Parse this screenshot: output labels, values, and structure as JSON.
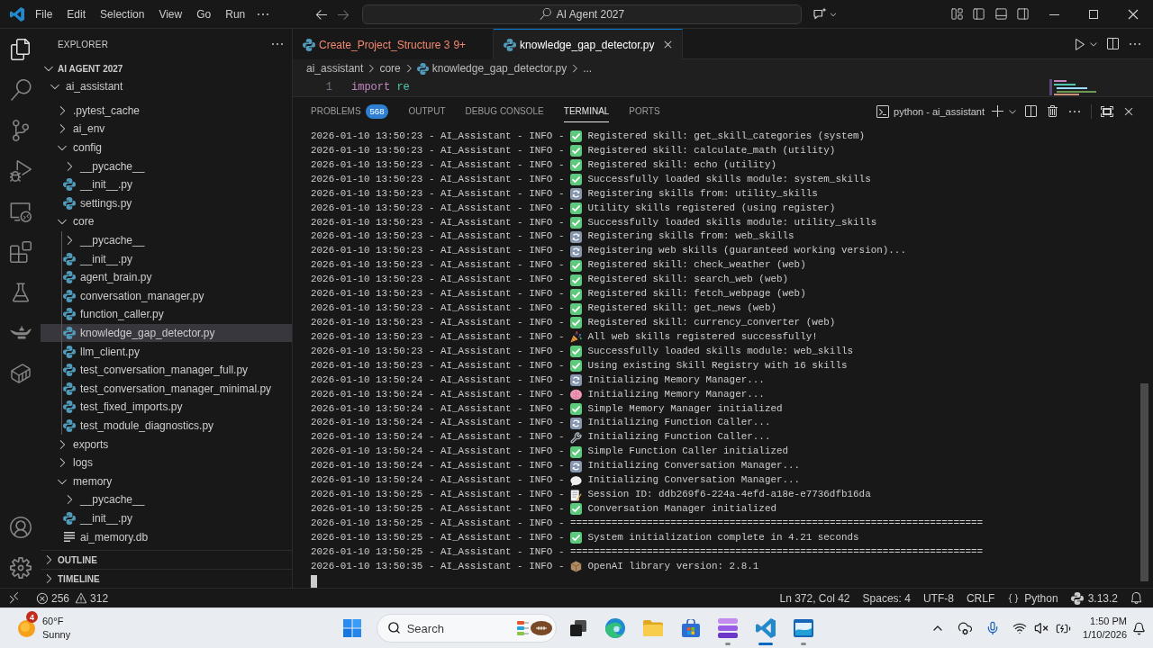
{
  "title_bar": {
    "menus": [
      "File",
      "Edit",
      "Selection",
      "View",
      "Go",
      "Run"
    ],
    "command_center": "AI Agent 2027"
  },
  "activity_bar": {
    "items": [
      {
        "kind": "explorer",
        "selected": true
      },
      {
        "kind": "search",
        "selected": false
      },
      {
        "kind": "source_control",
        "selected": false
      },
      {
        "kind": "run_debug",
        "selected": false
      },
      {
        "kind": "remote",
        "selected": false
      },
      {
        "kind": "extensions",
        "selected": false
      },
      {
        "kind": "testing",
        "selected": false
      },
      {
        "kind": "lamp",
        "selected": false
      },
      {
        "kind": "container",
        "selected": false
      }
    ],
    "bottom_items": [
      {
        "kind": "account"
      },
      {
        "kind": "settings"
      }
    ]
  },
  "sidebar": {
    "title": "EXPLORER",
    "workspace": {
      "label": "AI AGENT 2027",
      "expanded": true
    },
    "tree": [
      {
        "label": "ai_assistant",
        "kind": "folder",
        "expanded": true,
        "selected": false,
        "children": [
          {
            "label": ".pytest_cache",
            "kind": "folder",
            "expanded": false,
            "selected": false
          },
          {
            "label": "ai_env",
            "kind": "folder",
            "expanded": false,
            "selected": false
          },
          {
            "label": "config",
            "kind": "folder",
            "expanded": true,
            "selected": false,
            "children": [
              {
                "label": "__pycache__",
                "kind": "folder",
                "expanded": false,
                "selected": false
              },
              {
                "label": "__init__.py",
                "kind": "python",
                "selected": false
              },
              {
                "label": "settings.py",
                "kind": "python",
                "selected": false
              }
            ]
          },
          {
            "label": "core",
            "kind": "folder",
            "expanded": true,
            "selected": false,
            "children": [
              {
                "label": "__pycache__",
                "kind": "folder",
                "expanded": false,
                "selected": false
              },
              {
                "label": "__init__.py",
                "kind": "python",
                "selected": false
              },
              {
                "label": "agent_brain.py",
                "kind": "python",
                "selected": false
              },
              {
                "label": "conversation_manager.py",
                "kind": "python",
                "selected": false
              },
              {
                "label": "function_caller.py",
                "kind": "python",
                "selected": false
              },
              {
                "label": "knowledge_gap_detector.py",
                "kind": "python",
                "selected": true
              },
              {
                "label": "llm_client.py",
                "kind": "python",
                "selected": false
              },
              {
                "label": "test_conversation_manager_full.py",
                "kind": "python",
                "selected": false
              },
              {
                "label": "test_conversation_manager_minimal.py",
                "kind": "python",
                "selected": false
              },
              {
                "label": "test_fixed_imports.py",
                "kind": "python",
                "selected": false
              },
              {
                "label": "test_module_diagnostics.py",
                "kind": "python",
                "selected": false
              }
            ]
          },
          {
            "label": "exports",
            "kind": "folder",
            "expanded": false,
            "selected": false
          },
          {
            "label": "logs",
            "kind": "folder",
            "expanded": false,
            "selected": false
          },
          {
            "label": "memory",
            "kind": "folder",
            "expanded": true,
            "selected": false,
            "children": [
              {
                "label": "__pycache__",
                "kind": "folder",
                "expanded": false,
                "selected": false
              },
              {
                "label": "__init__.py",
                "kind": "python",
                "selected": false
              },
              {
                "label": "ai_memory.db",
                "kind": "text",
                "selected": false
              }
            ]
          }
        ]
      }
    ],
    "sections": [
      {
        "label": "OUTLINE",
        "expanded": false
      },
      {
        "label": "TIMELINE",
        "expanded": false
      }
    ]
  },
  "editor": {
    "tabs": [
      {
        "label": "Create_Project_Structure 3",
        "problems": "9+",
        "has_errors": true,
        "selected": false
      },
      {
        "label": "knowledge_gap_detector.py",
        "has_errors": false,
        "selected": true
      }
    ],
    "breadcrumbs": [
      {
        "label": "ai_assistant",
        "kind": "folder"
      },
      {
        "label": "core",
        "kind": "folder"
      },
      {
        "label": "knowledge_gap_detector.py",
        "kind": "python"
      },
      {
        "label": "...",
        "kind": "symbol"
      }
    ],
    "lines": [
      {
        "number": "1",
        "tokens": [
          {
            "text": "import",
            "kind": "keyword"
          },
          {
            "text": "re",
            "kind": "plain"
          }
        ]
      }
    ]
  },
  "panel": {
    "tabs": [
      {
        "label": "PROBLEMS",
        "badge": "568",
        "selected": false
      },
      {
        "label": "OUTPUT",
        "selected": false
      },
      {
        "label": "DEBUG CONSOLE",
        "selected": false
      },
      {
        "label": "TERMINAL",
        "selected": true
      },
      {
        "label": "PORTS",
        "selected": false
      }
    ],
    "terminal": {
      "name": "python - ai_assistant",
      "lines": [
        {
          "prefix": "2026-01-10 13:50:23 - AI_Assistant - INFO -",
          "kind": "check",
          "message": "Registered skill: get_skill_categories (system)"
        },
        {
          "prefix": "2026-01-10 13:50:23 - AI_Assistant - INFO -",
          "kind": "check",
          "message": "Registered skill: calculate_math (utility)"
        },
        {
          "prefix": "2026-01-10 13:50:23 - AI_Assistant - INFO -",
          "kind": "check",
          "message": "Registered skill: echo (utility)"
        },
        {
          "prefix": "2026-01-10 13:50:23 - AI_Assistant - INFO -",
          "kind": "check",
          "message": "Successfully loaded skills module: system_skills"
        },
        {
          "prefix": "2026-01-10 13:50:23 - AI_Assistant - INFO -",
          "kind": "sync",
          "message": "Registering skills from: utility_skills"
        },
        {
          "prefix": "2026-01-10 13:50:23 - AI_Assistant - INFO -",
          "kind": "check",
          "message": "Utility skills registered (using register)"
        },
        {
          "prefix": "2026-01-10 13:50:23 - AI_Assistant - INFO -",
          "kind": "check",
          "message": "Successfully loaded skills module: utility_skills"
        },
        {
          "prefix": "2026-01-10 13:50:23 - AI_Assistant - INFO -",
          "kind": "sync",
          "message": "Registering skills from: web_skills"
        },
        {
          "prefix": "2026-01-10 13:50:23 - AI_Assistant - INFO -",
          "kind": "sync",
          "message": "Registering web skills (guaranteed working version)..."
        },
        {
          "prefix": "2026-01-10 13:50:23 - AI_Assistant - INFO -",
          "kind": "check",
          "message": "Registered skill: check_weather (web)"
        },
        {
          "prefix": "2026-01-10 13:50:23 - AI_Assistant - INFO -",
          "kind": "check",
          "message": "Registered skill: search_web (web)"
        },
        {
          "prefix": "2026-01-10 13:50:23 - AI_Assistant - INFO -",
          "kind": "check",
          "message": "Registered skill: fetch_webpage (web)"
        },
        {
          "prefix": "2026-01-10 13:50:23 - AI_Assistant - INFO -",
          "kind": "check",
          "message": "Registered skill: get_news (web)"
        },
        {
          "prefix": "2026-01-10 13:50:23 - AI_Assistant - INFO -",
          "kind": "check",
          "message": "Registered skill: currency_converter (web)"
        },
        {
          "prefix": "2026-01-10 13:50:23 - AI_Assistant - INFO -",
          "kind": "party",
          "message": "All web skills registered successfully!"
        },
        {
          "prefix": "2026-01-10 13:50:23 - AI_Assistant - INFO -",
          "kind": "check",
          "message": "Successfully loaded skills module: web_skills"
        },
        {
          "prefix": "2026-01-10 13:50:23 - AI_Assistant - INFO -",
          "kind": "check",
          "message": "Using existing Skill Registry with 16 skills"
        },
        {
          "prefix": "2026-01-10 13:50:24 - AI_Assistant - INFO -",
          "kind": "sync",
          "message": "Initializing Memory Manager..."
        },
        {
          "prefix": "2026-01-10 13:50:24 - AI_Assistant - INFO -",
          "kind": "brain",
          "message": "Initializing Memory Manager..."
        },
        {
          "prefix": "2026-01-10 13:50:24 - AI_Assistant - INFO -",
          "kind": "check",
          "message": "Simple Memory Manager initialized"
        },
        {
          "prefix": "2026-01-10 13:50:24 - AI_Assistant - INFO -",
          "kind": "sync",
          "message": "Initializing Function Caller..."
        },
        {
          "prefix": "2026-01-10 13:50:24 - AI_Assistant - INFO -",
          "kind": "wrench",
          "message": "Initializing Function Caller..."
        },
        {
          "prefix": "2026-01-10 13:50:24 - AI_Assistant - INFO -",
          "kind": "check",
          "message": "Simple Function Caller initialized"
        },
        {
          "prefix": "2026-01-10 13:50:24 - AI_Assistant - INFO -",
          "kind": "sync",
          "message": "Initializing Conversation Manager..."
        },
        {
          "prefix": "2026-01-10 13:50:24 - AI_Assistant - INFO -",
          "kind": "chat",
          "message": "Initializing Conversation Manager..."
        },
        {
          "prefix": "2026-01-10 13:50:25 - AI_Assistant - INFO -",
          "kind": "memo",
          "message": "Session ID: ddb269f6-224a-4efd-a18e-e7736dfb16da"
        },
        {
          "prefix": "2026-01-10 13:50:25 - AI_Assistant - INFO -",
          "kind": "check",
          "message": "Conversation Manager initialized"
        },
        {
          "prefix": "2026-01-10 13:50:25 - AI_Assistant - INFO -",
          "kind": "plain",
          "message": "======================================================================"
        },
        {
          "prefix": "2026-01-10 13:50:25 - AI_Assistant - INFO -",
          "kind": "check",
          "message": "System initialization complete in 4.21 seconds"
        },
        {
          "prefix": "2026-01-10 13:50:25 - AI_Assistant - INFO -",
          "kind": "plain",
          "message": "======================================================================"
        },
        {
          "prefix": "2026-01-10 13:50:35 - AI_Assistant - INFO -",
          "kind": "package",
          "message": "OpenAI library version: 2.8.1"
        }
      ]
    }
  },
  "status_bar": {
    "errors": "256",
    "warnings": "312",
    "items": [
      {
        "kind": "text",
        "label": "Ln 372, Col 42"
      },
      {
        "kind": "text",
        "label": "Spaces: 4"
      },
      {
        "kind": "text",
        "label": "UTF-8"
      },
      {
        "kind": "text",
        "label": "CRLF"
      },
      {
        "kind": "language",
        "label": "Python"
      },
      {
        "kind": "interpreter",
        "label": "3.13.2"
      }
    ]
  },
  "taskbar": {
    "weather": {
      "alerts": "4",
      "temperature": "60°F",
      "condition": "Sunny"
    },
    "search": {
      "placeholder": "Search"
    },
    "apps": [
      {
        "kind": "task_view",
        "running": false,
        "selected": false
      },
      {
        "kind": "browser",
        "running": false,
        "selected": false
      },
      {
        "kind": "files",
        "running": false,
        "selected": false
      },
      {
        "kind": "store",
        "running": false,
        "selected": false
      },
      {
        "kind": "layers",
        "running": true,
        "selected": false
      },
      {
        "kind": "code",
        "running": true,
        "selected": true
      },
      {
        "kind": "window",
        "running": true,
        "selected": false
      }
    ],
    "clock": {
      "time": "1:50 PM",
      "date": "1/10/2026"
    }
  }
}
